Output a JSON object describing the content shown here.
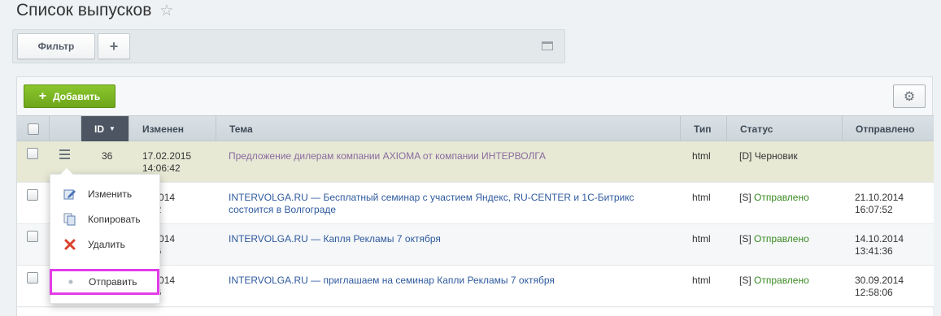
{
  "page": {
    "title": "Список выпусков"
  },
  "filter_bar": {
    "filter_label": "Фильтр",
    "plus_label": "+"
  },
  "toolbar": {
    "add_label": "Добавить"
  },
  "table": {
    "headers": {
      "id": "ID",
      "changed": "Изменен",
      "subject": "Тема",
      "type": "Тип",
      "status": "Статус",
      "sent": "Отправлено"
    },
    "rows": [
      {
        "id": "36",
        "changed_date": "17.02.2015",
        "changed_time": "14:06:42",
        "subject": "Предложение дилерам компании AXIOMA от компании ИНТЕРВОЛГА",
        "subject_line2": "",
        "type": "html",
        "status_code": "[D]",
        "status_text": "Черновик",
        "sent_date": "",
        "sent_time": ""
      },
      {
        "id": "",
        "changed_date": ".0.2014",
        "changed_time": "7:52",
        "subject": "INTERVOLGA.RU — Бесплатный семинар с участием Яндекс, RU-CENTER и 1С-Битрикс",
        "subject_line2": "состоится в Волгограде",
        "type": "html",
        "status_code": "[S]",
        "status_text": "Отправлено",
        "sent_date": "21.10.2014",
        "sent_time": "16:07:52"
      },
      {
        "id": "",
        "changed_date": ".0.2014",
        "changed_time": "1:36",
        "subject": "INTERVOLGA.RU — Капля Рекламы 7 октября",
        "subject_line2": "",
        "type": "html",
        "status_code": "[S]",
        "status_text": "Отправлено",
        "sent_date": "14.10.2014",
        "sent_time": "13:41:36"
      },
      {
        "id": "",
        "changed_date": ".9.2014",
        "changed_time": "8:06",
        "subject": "INTERVOLGA.RU — приглашаем на семинар Капли Рекламы 7 октября",
        "subject_line2": "",
        "type": "html",
        "status_code": "[S]",
        "status_text": "Отправлено",
        "sent_date": "30.09.2014",
        "sent_time": "12:58:06"
      }
    ]
  },
  "context_menu": {
    "items": [
      {
        "label": "Изменить",
        "icon": "edit-icon"
      },
      {
        "label": "Копировать",
        "icon": "copy-icon"
      },
      {
        "label": "Удалить",
        "icon": "delete-icon"
      },
      {
        "label": "Отправить",
        "icon": "dot-icon"
      }
    ]
  },
  "colors": {
    "add_button": "#79b425",
    "sent_status": "#3b8a24",
    "selected_row": "#e7e9d5",
    "highlight_outline": "#e23be8"
  }
}
